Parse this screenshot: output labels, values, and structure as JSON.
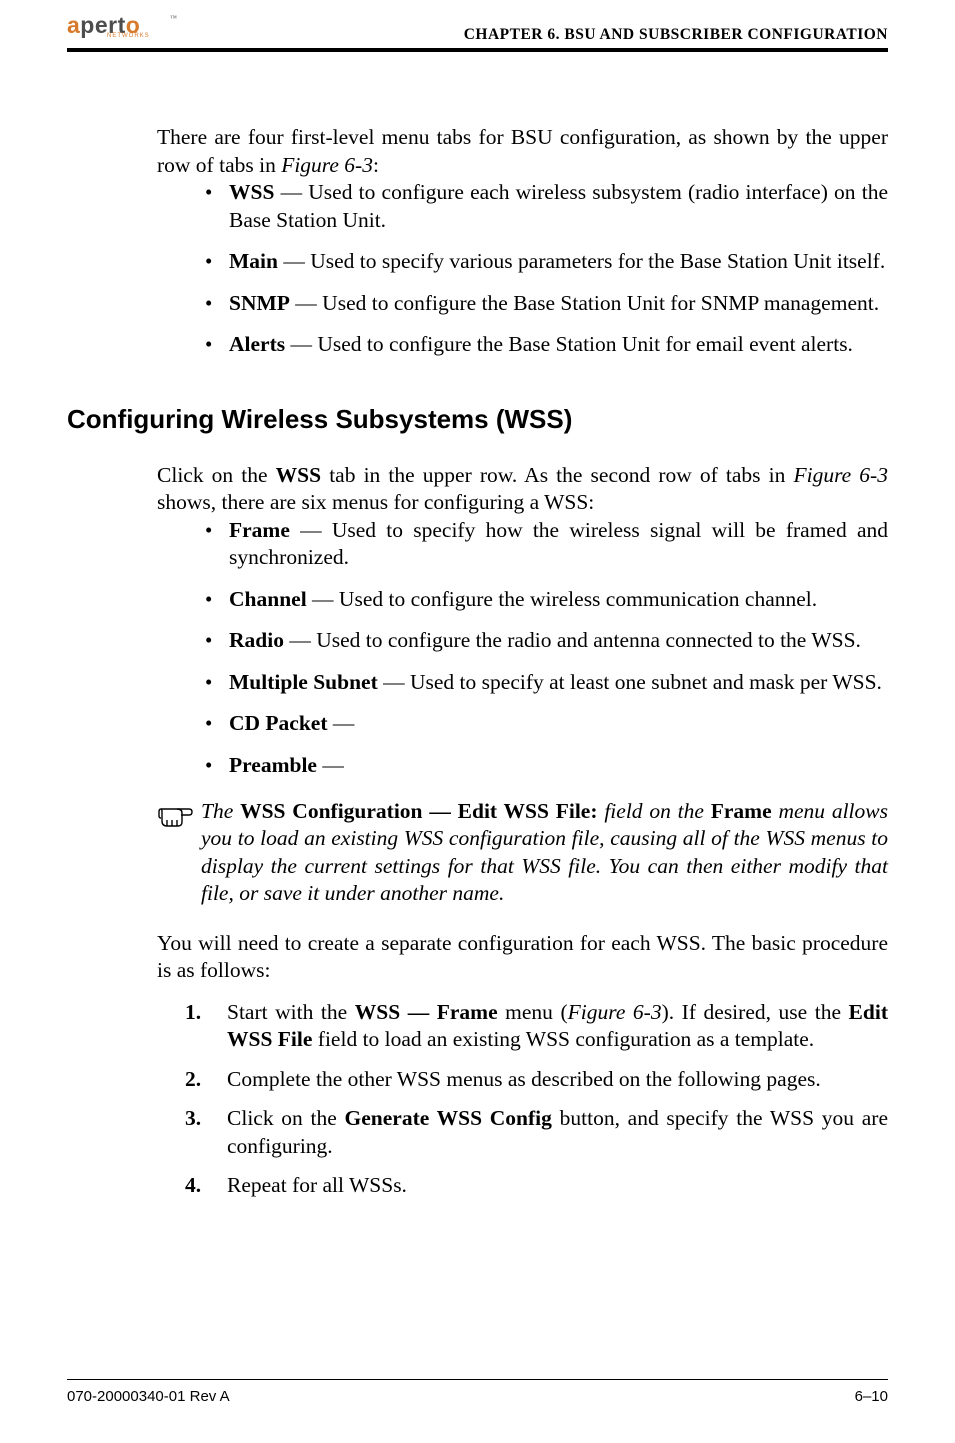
{
  "header": {
    "logo_main": "aperto",
    "logo_sub": "NETWORKS",
    "running_head": "CHAPTER 6.   BSU AND SUBSCRIBER CONFIGURATION"
  },
  "intro": {
    "text_a": "There are four first-level menu tabs for BSU configuration, as shown by the upper row of tabs in ",
    "figref": "Figure 6-3",
    "text_b": ":"
  },
  "first_level_tabs": [
    {
      "term": "WSS",
      "desc": " — Used to configure each wireless subsystem (radio interface) on the Base Station Unit."
    },
    {
      "term": "Main",
      "desc": " — Used to specify various parameters for the Base Station Unit itself."
    },
    {
      "term": "SNMP",
      "desc": " — Used to configure the Base Station Unit for SNMP management."
    },
    {
      "term": "Alerts",
      "desc": " — Used to configure the Base Station Unit for email event alerts."
    }
  ],
  "section_heading": "Configuring Wireless Subsystems (WSS)",
  "wss_intro": {
    "a": "Click on the ",
    "b": "WSS",
    "c": " tab in the upper row. As the second row of tabs in ",
    "figref": "Figure 6-3",
    "d": " shows, there are six menus for configuring a WSS:"
  },
  "wss_menus": [
    {
      "term": "Frame",
      "desc": " — Used to specify how the wireless signal will be framed and synchro­nized."
    },
    {
      "term": "Channel",
      "desc": " — Used to configure the wireless communication channel."
    },
    {
      "term": "Radio",
      "desc": " — Used to configure the radio and antenna connected to the WSS."
    },
    {
      "term": "Multiple Subnet",
      "desc": " — Used to specify at least one subnet and mask per WSS."
    },
    {
      "term": "CD Packet",
      "desc": " — "
    },
    {
      "term": "Preamble",
      "desc": " — "
    }
  ],
  "note": {
    "a": "The ",
    "b": "WSS Configuration — Edit WSS File:",
    "c": " field on the ",
    "d": "Frame",
    "e": " menu allows you to load an existing WSS configuration file, causing all of the WSS menus to dis­play the current settings for that WSS file. You can then either modify that file, or save it under another name."
  },
  "procedure_intro": "You will need to create a separate configuration for each WSS. The basic procedure is as follows:",
  "steps": {
    "s1": {
      "a": "Start with the ",
      "b": "WSS — Frame",
      "c": " menu (",
      "figref": "Figure 6-3",
      "d": "). If desired, use the ",
      "e": "Edit WSS File",
      "f": " field to load an existing WSS configuration as a template."
    },
    "s2": "Complete the other WSS menus as described on the following pages.",
    "s3": {
      "a": "Click on the ",
      "b": "Generate WSS Config",
      "c": " button, and specify the WSS you are con­figuring."
    },
    "s4": "Repeat for all WSSs."
  },
  "footer": {
    "doc_id": "070-20000340-01 Rev A",
    "page": "6–10"
  }
}
